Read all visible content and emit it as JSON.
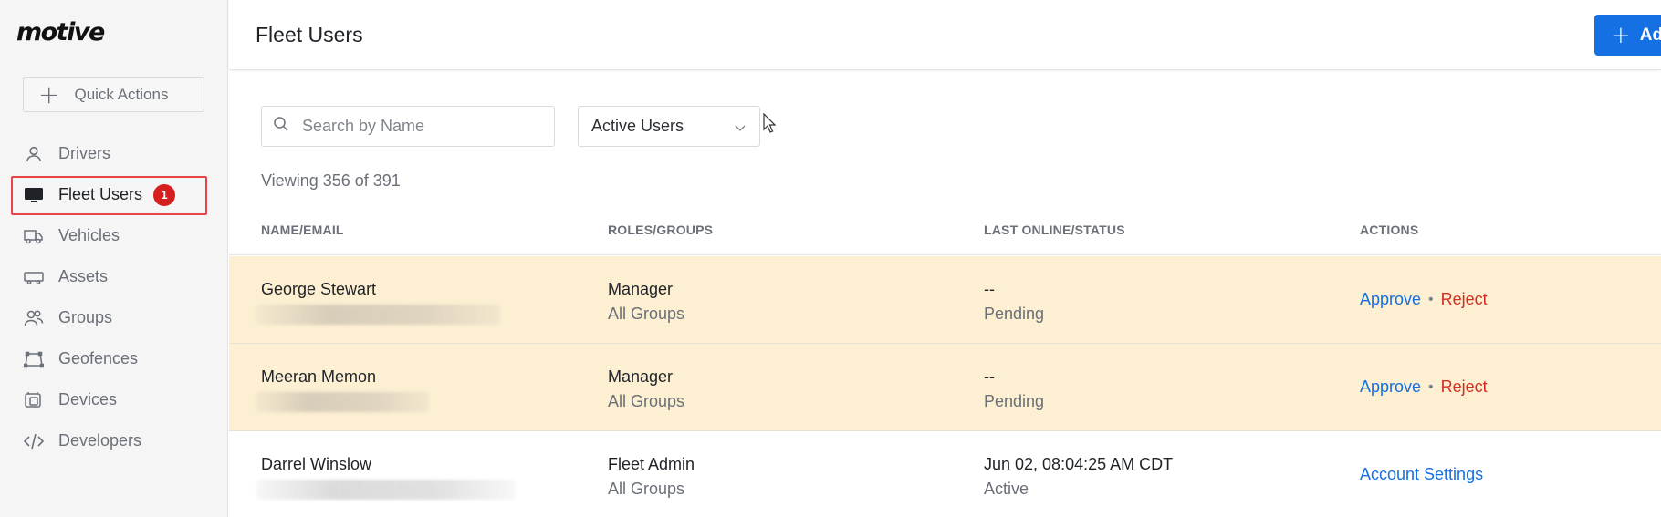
{
  "brand": {
    "logo_text": "motive"
  },
  "sidebar": {
    "quick_actions_label": "Quick Actions",
    "items": [
      {
        "label": "Drivers",
        "icon": "person-icon"
      },
      {
        "label": "Fleet Users",
        "icon": "monitor-icon",
        "badge": "1",
        "active": true
      },
      {
        "label": "Vehicles",
        "icon": "truck-icon"
      },
      {
        "label": "Assets",
        "icon": "trailer-icon"
      },
      {
        "label": "Groups",
        "icon": "users-icon"
      },
      {
        "label": "Geofences",
        "icon": "geofence-icon"
      },
      {
        "label": "Devices",
        "icon": "device-icon"
      },
      {
        "label": "Developers",
        "icon": "code-icon"
      }
    ]
  },
  "header": {
    "title": "Fleet Users",
    "add_label": "Add"
  },
  "filters": {
    "search_placeholder": "Search by Name",
    "search_value": "",
    "status_selected": "Active Users"
  },
  "viewing_text": "Viewing 356 of 391",
  "table": {
    "columns": [
      "NAME/EMAIL",
      "ROLES/GROUPS",
      "LAST ONLINE/STATUS",
      "ACTIONS"
    ],
    "rows": [
      {
        "name": "George Stewart",
        "role": "Manager",
        "groups": "All Groups",
        "last_online": "--",
        "status": "Pending",
        "action_primary": "Approve",
        "action_secondary": "Reject"
      },
      {
        "name": "Meeran Memon",
        "role": "Manager",
        "groups": "All Groups",
        "last_online": "--",
        "status": "Pending",
        "action_primary": "Approve",
        "action_secondary": "Reject"
      },
      {
        "name": "Darrel Winslow",
        "role": "Fleet Admin",
        "groups": "All Groups",
        "last_online": "Jun 02, 08:04:25 AM CDT",
        "status": "Active",
        "action_primary": "Account Settings"
      }
    ]
  },
  "colors": {
    "accent": "#1570e4",
    "danger": "#d62c1f",
    "pending_row": "#fcefd2",
    "badge": "#d61f1f"
  }
}
